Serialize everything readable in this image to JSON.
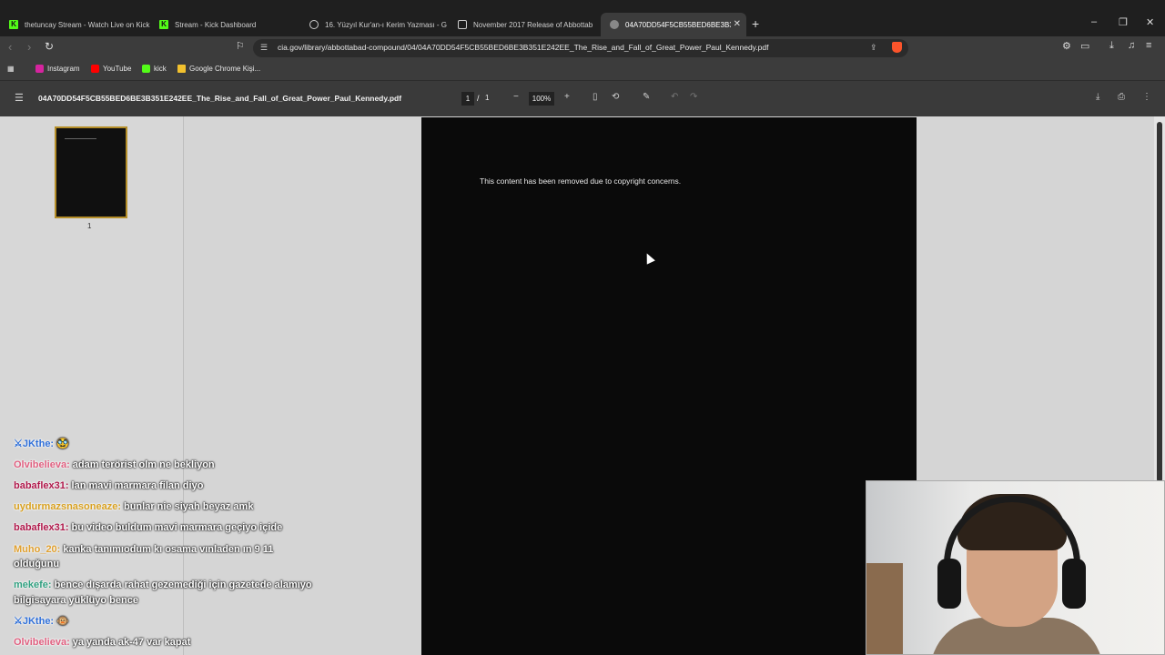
{
  "browser": {
    "tabs": [
      {
        "label": "thetuncay Stream - Watch Live on Kick",
        "icon": "kick-icon"
      },
      {
        "label": "Stream - Kick Dashboard",
        "icon": "kick-icon"
      },
      {
        "label": "16. Yüzyıl Kur'an-ı Kerim Yazması - G",
        "icon": "loading-icon"
      },
      {
        "label": "November 2017 Release of Abbottab",
        "icon": "page-icon"
      },
      {
        "label": "04A70DD54F5CB55BED6BE3B35",
        "icon": "pdf-icon",
        "active": true
      }
    ],
    "url": "cia.gov/library/abbottabad-compound/04/04A70DD54F5CB55BED6BE3B351E242EE_The_Rise_and_Fall_of_Great_Power_Paul_Kennedy.pdf",
    "bookmarks": [
      {
        "label": "Instagram",
        "color": "#d6249f"
      },
      {
        "label": "YouTube",
        "color": "#ff0000"
      },
      {
        "label": "kick",
        "color": "#53fc18"
      },
      {
        "label": "Google Chrome Kişi...",
        "color": "#f2c12e"
      }
    ]
  },
  "pdf": {
    "title": "04A70DD54F5CB55BED6BE3B351E242EE_The_Rise_and_Fall_of_Great_Power_Paul_Kennedy.pdf",
    "page_current": "1",
    "page_separator": "/",
    "page_total": "1",
    "zoom": "100%",
    "thumbnail_label": "1",
    "page_text": "This content has been removed due to copyright concerns."
  },
  "chat": [
    {
      "user": "JKthe:",
      "text": "🥸",
      "color": "#2f6fd8"
    },
    {
      "user": "Olvibelieva:",
      "text": "adam terörist olm ne bekliyon",
      "color": "#e06080"
    },
    {
      "user": "babaflex31:",
      "text": "lan mavi marmara filan diyo",
      "color": "#b0174a"
    },
    {
      "user": "uydurmazsnasoneaze:",
      "text": "bunlar nie siyah beyaz amk",
      "color": "#d8a020"
    },
    {
      "user": "babaflex31:",
      "text": "bu video buldum mavi marmara geçiyo içide",
      "color": "#b0174a"
    },
    {
      "user": "Muho_20:",
      "text": "kanka tanımıodum kı osama vınladen ın 9 11",
      "text2": "olduğunu",
      "color": "#e0a030"
    },
    {
      "user": "mekefe:",
      "text": "bence dışarda rahat gezemediği için gazetede alamıyo",
      "text2": "bilgisayara yüklüyo bence",
      "color": "#30a080"
    },
    {
      "user": "JKthe:",
      "text": "🐵",
      "color": "#2f6fd8"
    },
    {
      "user": "Olvibelieva:",
      "text": "ya yanda ak-47 var kapat",
      "color": "#e06080"
    }
  ]
}
